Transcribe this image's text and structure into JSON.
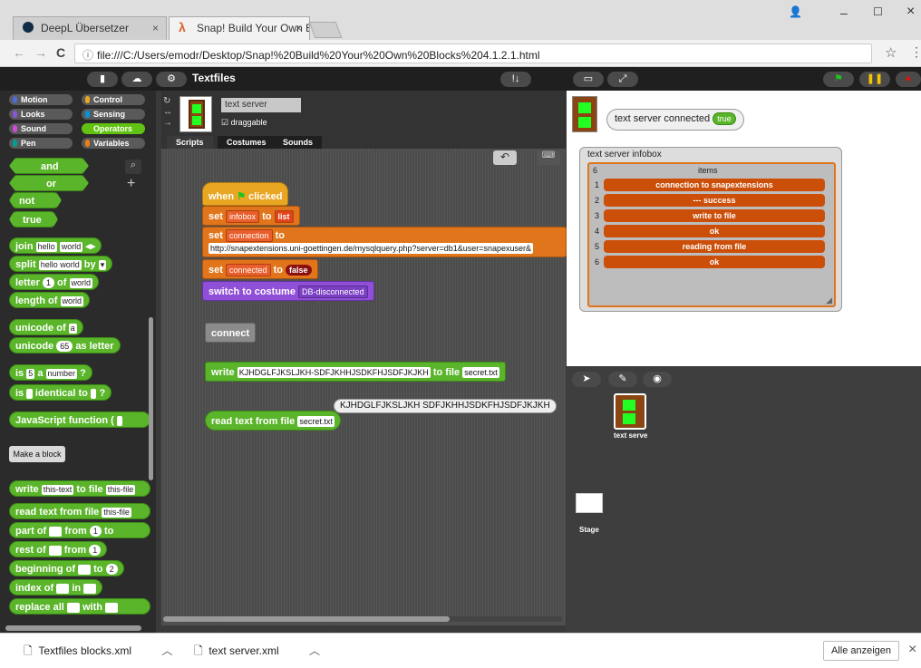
{
  "browser": {
    "tabs": [
      {
        "label": "DeepL Übersetzer",
        "close": "×"
      },
      {
        "label": "Snap! Build Your Own Blc",
        "close": "×"
      }
    ],
    "window_controls": {
      "minimize": "–",
      "maximize": "☐",
      "close": "×",
      "account": "👤"
    },
    "nav": {
      "back": "←",
      "forward": "→",
      "reload": "C",
      "info": "ⓘ"
    },
    "url": "file:///C:/Users/emodr/Desktop/Snap!%20Build%20Your%20Own%20Blocks%204.1.2.1.html",
    "star": "☆",
    "menu": "⋮"
  },
  "snap": {
    "project_title": "Textfiles",
    "categories": [
      {
        "label": "Motion",
        "color": "#4a6cd4"
      },
      {
        "label": "Control",
        "color": "#e6a822"
      },
      {
        "label": "Looks",
        "color": "#8a55d7"
      },
      {
        "label": "Sensing",
        "color": "#0494dc"
      },
      {
        "label": "Sound",
        "color": "#cf4ad9"
      },
      {
        "label": "Operators",
        "color": "#62c213"
      },
      {
        "label": "Pen",
        "color": "#009e96"
      },
      {
        "label": "Variables",
        "color": "#ee7d16"
      }
    ],
    "palette": {
      "and": "and",
      "or": "or",
      "not": "not",
      "true": "true",
      "join": "join",
      "join_a": "hello",
      "join_b": "world",
      "split": "split",
      "split_a": "hello world",
      "split_by": "by",
      "letter": "letter",
      "letter_n": "1",
      "letter_of": "of",
      "letter_w": "world",
      "length": "length of",
      "length_w": "world",
      "unicode_of": "unicode of",
      "unicode_a": "a",
      "unicode_as": "unicode",
      "unicode_n": "65",
      "unicode_letter": "as letter",
      "is_a": "is",
      "is_n": "5",
      "is_a2": "a",
      "is_type": "number",
      "q": "?",
      "identical": "is",
      "identical_to": "identical to",
      "identical_q": "?",
      "js": "JavaScript function (",
      "make_block": "Make a block",
      "write": "write",
      "write_text": "this-text",
      "write_to": "to file",
      "write_file": "this-file",
      "read": "read text from file",
      "read_file": "this-file",
      "part": "part of",
      "part_from": "from",
      "part_n": "1",
      "part_to": "to",
      "rest": "rest of",
      "rest_from": "from",
      "rest_n": "1",
      "beginning": "beginning of",
      "beginning_to": "to",
      "beginning_n": "2",
      "index": "index of",
      "index_in": "in",
      "replace": "replace all",
      "replace_with": "with"
    },
    "sprite": {
      "name": "text server",
      "draggable": "draggable",
      "tabs": [
        "Scripts",
        "Costumes",
        "Sounds"
      ]
    },
    "scripts": {
      "when": "when",
      "clicked": "clicked",
      "set1": "set",
      "set1_var": "infobox",
      "set1_to": "to",
      "set1_val": "list",
      "set2": "set",
      "set2_var": "connection",
      "set2_to": "to",
      "set2_val": "http://snapextensions.uni-goettingen.de/mysqlquery.php?server=db1&user=snapexuser&",
      "set3": "set",
      "set3_var": "connected",
      "set3_to": "to",
      "set3_val": "false",
      "switch": "switch to costume",
      "switch_val": "DB-disconnected",
      "connect": "connect",
      "write": "write",
      "write_text": "KJHDGLFJKSLJKH-SDFJKHHJSDKFHJSDFJKJKH",
      "write_to": "to file",
      "write_file": "secret.txt",
      "bubble": "KJHDGLFJKSLJKH SDFJKHHJSDKFHJSDFJKJKH",
      "read": "read text from file",
      "read_file": "secret.txt"
    },
    "stage": {
      "watcher_label": "text server connected",
      "watcher_value": "true",
      "list_title": "text server infobox",
      "list_count": "6",
      "list_header": "items",
      "items": [
        "connection to snapextensions",
        "--- success",
        "write to file",
        "ok",
        "reading from file",
        "ok"
      ],
      "indices": [
        "1",
        "2",
        "3",
        "4",
        "5",
        "6"
      ]
    },
    "corral": {
      "sprite_label": "text serve",
      "stage_label": "Stage"
    }
  },
  "downloads": {
    "items": [
      "Textfiles blocks.xml",
      "text server.xml"
    ],
    "show_all": "Alle anzeigen",
    "close": "×"
  }
}
